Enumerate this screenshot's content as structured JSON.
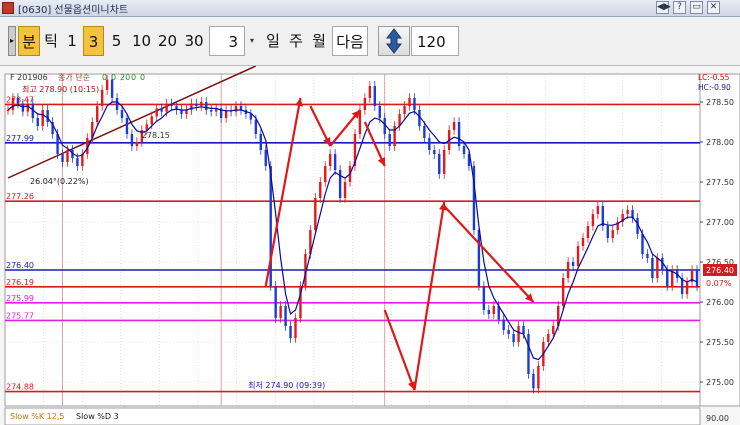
{
  "window": {
    "title": "[0630] 선물옵션미니차트",
    "icon": "app-icon",
    "buttons": [
      "◀▶",
      "?",
      "▭",
      "✕"
    ]
  },
  "toolbar": {
    "grip": "▸",
    "period_buttons": [
      "분",
      "틱",
      "1",
      "3",
      "5",
      "10",
      "20",
      "30"
    ],
    "selected_period": "3",
    "interval_value": "3",
    "interval_dropdown": "▾",
    "unit_buttons": [
      "일",
      "주",
      "월"
    ],
    "next_label": "다음",
    "updown_icon": "up-down-arrows-icon",
    "count_value": "120"
  },
  "colors": {
    "grid": "#cbcbcb",
    "up_candle": "#e11b1b",
    "down_candle": "#1c3ad8",
    "ma_line": "#0a0a9c",
    "red_level": "#d41c1c",
    "blue_level": "#1a1ab8",
    "magenta_level": "#e020e0",
    "trendline": "#7a1010",
    "arrow": "#e01818"
  },
  "chart_data": {
    "type": "line",
    "symbol_label": "F 201906",
    "legend_items": [
      "종가 단순",
      "0",
      "0",
      "20",
      "0",
      "0"
    ],
    "high_label": "최고 278.90 (10:15)",
    "low_label": "최저 274.90 (09:39)",
    "lc_label": "LC:-0.55",
    "hc_label": "HC:-0.90",
    "trend_start_label": "26.04°(0.22%)",
    "trend_mid_label": "278.15",
    "last_price_label": "276.40",
    "last_change_label": "0.07%",
    "ylim": [
      274.7,
      278.85
    ],
    "y_ticks": [
      {
        "value": 275.0,
        "label": "275.00"
      },
      {
        "value": 275.5,
        "label": "275.50"
      },
      {
        "value": 276.0,
        "label": "276.00"
      },
      {
        "value": 276.5,
        "label": "276.50"
      },
      {
        "value": 277.0,
        "label": "277.00"
      },
      {
        "value": 277.5,
        "label": "277.50"
      },
      {
        "value": 278.0,
        "label": "278.00"
      },
      {
        "value": 278.5,
        "label": "278.50"
      }
    ],
    "levels": [
      {
        "value": 278.47,
        "label": "278.47",
        "color": "#d41c1c"
      },
      {
        "value": 277.99,
        "label": "277.99",
        "color": "#1a1ab8"
      },
      {
        "value": 277.26,
        "label": "277.26",
        "color": "#d41c1c"
      },
      {
        "value": 276.4,
        "label": "276.40",
        "color": "#1a1ab8"
      },
      {
        "value": 276.19,
        "label": "276.19",
        "color": "#d41c1c"
      },
      {
        "value": 275.99,
        "label": "275.99",
        "color": "#e020e0"
      },
      {
        "value": 275.77,
        "label": "275.77",
        "color": "#e020e0"
      },
      {
        "value": 274.88,
        "label": "274.88",
        "color": "#d41c1c"
      }
    ],
    "series": [
      {
        "name": "종가",
        "values": [
          278.4,
          278.55,
          278.48,
          278.38,
          278.48,
          278.3,
          278.2,
          278.4,
          278.25,
          278.1,
          277.85,
          277.75,
          277.9,
          277.8,
          277.7,
          277.85,
          278.05,
          278.25,
          278.45,
          278.65,
          278.78,
          278.55,
          278.4,
          278.3,
          278.1,
          277.95,
          278.0,
          278.15,
          278.22,
          278.32,
          278.42,
          278.38,
          278.48,
          278.45,
          278.4,
          278.35,
          278.4,
          278.48,
          278.45,
          278.5,
          278.4,
          278.38,
          278.42,
          278.3,
          278.4,
          278.38,
          278.45,
          278.4,
          278.35,
          278.28,
          278.1,
          277.9,
          277.7,
          276.2,
          275.8,
          275.95,
          275.7,
          275.55,
          275.8,
          276.2,
          276.6,
          276.9,
          277.3,
          277.5,
          277.7,
          277.85,
          277.65,
          277.3,
          277.5,
          277.7,
          278.1,
          278.4,
          278.55,
          278.7,
          278.45,
          278.3,
          278.1,
          277.95,
          278.2,
          278.35,
          278.45,
          278.55,
          278.4,
          278.2,
          278.05,
          277.9,
          277.85,
          277.6,
          277.9,
          278.15,
          278.25,
          277.95,
          277.85,
          277.7,
          276.9,
          276.2,
          275.9,
          275.85,
          275.95,
          275.78,
          275.65,
          275.6,
          275.5,
          275.7,
          275.6,
          275.1,
          274.92,
          275.2,
          275.5,
          275.6,
          275.7,
          275.95,
          276.3,
          276.5,
          276.45,
          276.7,
          276.8,
          276.95,
          277.1,
          277.2,
          276.95,
          276.8,
          276.9,
          277.0,
          277.1,
          277.15,
          277.05,
          276.85,
          276.6,
          276.55,
          276.3,
          276.55,
          276.4,
          276.2,
          276.4,
          276.3,
          276.1,
          276.25,
          276.4,
          276.2
        ]
      },
      {
        "name": "MA",
        "values": [
          278.4,
          278.45,
          278.46,
          278.44,
          278.45,
          278.4,
          278.35,
          278.34,
          278.3,
          278.22,
          278.1,
          277.96,
          277.92,
          277.86,
          277.82,
          277.84,
          277.92,
          278.05,
          278.2,
          278.32,
          278.45,
          278.5,
          278.5,
          278.45,
          278.35,
          278.22,
          278.14,
          278.12,
          278.14,
          278.2,
          278.26,
          278.3,
          278.36,
          278.4,
          278.41,
          278.4,
          278.4,
          278.42,
          278.43,
          278.44,
          278.43,
          278.42,
          278.42,
          278.4,
          278.39,
          278.39,
          278.4,
          278.4,
          278.38,
          278.36,
          278.3,
          278.18,
          278.02,
          277.6,
          277.1,
          276.55,
          276.1,
          275.85,
          275.9,
          276.1,
          276.35,
          276.6,
          276.85,
          277.1,
          277.35,
          277.55,
          277.62,
          277.58,
          277.55,
          277.6,
          277.75,
          277.92,
          278.1,
          278.25,
          278.3,
          278.28,
          278.22,
          278.15,
          278.15,
          278.2,
          278.28,
          278.36,
          278.38,
          278.32,
          278.24,
          278.15,
          278.08,
          278.0,
          277.98,
          278.02,
          278.06,
          278.04,
          278.0,
          277.9,
          277.5,
          276.95,
          276.5,
          276.2,
          276.05,
          275.95,
          275.85,
          275.75,
          275.65,
          275.62,
          275.6,
          275.45,
          275.3,
          275.28,
          275.35,
          275.45,
          275.55,
          275.7,
          275.9,
          276.1,
          276.25,
          276.42,
          276.55,
          276.68,
          276.82,
          276.95,
          276.98,
          276.96,
          276.96,
          276.98,
          277.02,
          277.06,
          277.06,
          276.98,
          276.85,
          276.75,
          276.6,
          276.55,
          276.5,
          276.4,
          276.38,
          276.35,
          276.28,
          276.25,
          276.28,
          276.25
        ]
      }
    ],
    "trendline": {
      "from": [
        0,
        277.55
      ],
      "to": [
        50,
        278.95
      ]
    },
    "arrows": [
      {
        "from": [
          52,
          276.2
        ],
        "to": [
          59,
          278.55
        ]
      },
      {
        "from": [
          61,
          278.45
        ],
        "to": [
          65,
          277.95
        ]
      },
      {
        "from": [
          65,
          277.95
        ],
        "to": [
          71,
          278.4
        ]
      },
      {
        "from": [
          72,
          278.25
        ],
        "to": [
          76,
          277.7
        ]
      },
      {
        "from": [
          76,
          275.9
        ],
        "to": [
          82,
          274.9
        ]
      },
      {
        "from": [
          82,
          274.9
        ],
        "to": [
          88,
          277.25
        ]
      },
      {
        "from": [
          88,
          277.2
        ],
        "to": [
          106,
          276.0
        ]
      }
    ],
    "session_dividers": [
      11,
      43,
      76
    ],
    "stochastic": {
      "k_label": "Slow %K 12,5",
      "d_label": "Slow %D 3",
      "level_label": "90.00"
    }
  }
}
